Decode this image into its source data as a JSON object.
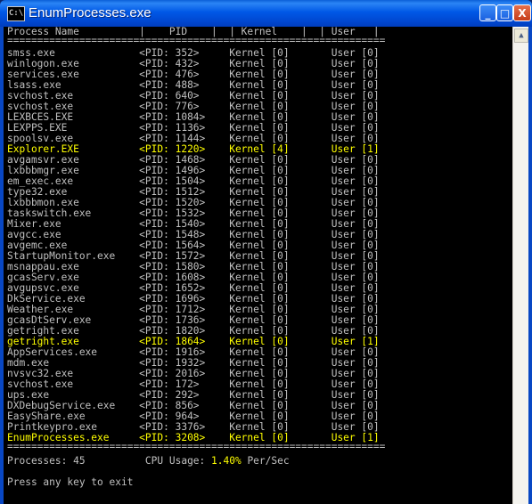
{
  "window": {
    "title": "EnumProcesses.exe",
    "icon_text": "C:\\",
    "buttons": {
      "minimize": "_",
      "maximize": "□",
      "close": "X"
    }
  },
  "console": {
    "header": "Process Name          |    PID    |  | Kernel    |  | User   |",
    "separator_top": "===============================================================",
    "rows": [
      {
        "text": "smss.exe              <PID: 352>     Kernel [0]       User [0]",
        "highlight": false
      },
      {
        "text": "winlogon.exe          <PID: 432>     Kernel [0]       User [0]",
        "highlight": false
      },
      {
        "text": "services.exe          <PID: 476>     Kernel [0]       User [0]",
        "highlight": false
      },
      {
        "text": "lsass.exe             <PID: 488>     Kernel [0]       User [0]",
        "highlight": false
      },
      {
        "text": "svchost.exe           <PID: 640>     Kernel [0]       User [0]",
        "highlight": false
      },
      {
        "text": "svchost.exe           <PID: 776>     Kernel [0]       User [0]",
        "highlight": false
      },
      {
        "text": "LEXBCES.EXE           <PID: 1084>    Kernel [0]       User [0]",
        "highlight": false
      },
      {
        "text": "LEXPPS.EXE            <PID: 1136>    Kernel [0]       User [0]",
        "highlight": false
      },
      {
        "text": "spoolsv.exe           <PID: 1144>    Kernel [0]       User [0]",
        "highlight": false
      },
      {
        "text": "Explorer.EXE          <PID: 1220>    Kernel [4]       User [1]",
        "highlight": true
      },
      {
        "text": "avgamsvr.exe          <PID: 1468>    Kernel [0]       User [0]",
        "highlight": false
      },
      {
        "text": "lxbbbmgr.exe          <PID: 1496>    Kernel [0]       User [0]",
        "highlight": false
      },
      {
        "text": "em_exec.exe           <PID: 1504>    Kernel [0]       User [0]",
        "highlight": false
      },
      {
        "text": "type32.exe            <PID: 1512>    Kernel [0]       User [0]",
        "highlight": false
      },
      {
        "text": "lxbbbmon.exe          <PID: 1520>    Kernel [0]       User [0]",
        "highlight": false
      },
      {
        "text": "taskswitch.exe        <PID: 1532>    Kernel [0]       User [0]",
        "highlight": false
      },
      {
        "text": "Mixer.exe             <PID: 1540>    Kernel [0]       User [0]",
        "highlight": false
      },
      {
        "text": "avgcc.exe             <PID: 1548>    Kernel [0]       User [0]",
        "highlight": false
      },
      {
        "text": "avgemc.exe            <PID: 1564>    Kernel [0]       User [0]",
        "highlight": false
      },
      {
        "text": "StartupMonitor.exe    <PID: 1572>    Kernel [0]       User [0]",
        "highlight": false
      },
      {
        "text": "msnappau.exe          <PID: 1580>    Kernel [0]       User [0]",
        "highlight": false
      },
      {
        "text": "gcasServ.exe          <PID: 1608>    Kernel [0]       User [0]",
        "highlight": false
      },
      {
        "text": "avgupsvc.exe          <PID: 1652>    Kernel [0]       User [0]",
        "highlight": false
      },
      {
        "text": "DkService.exe         <PID: 1696>    Kernel [0]       User [0]",
        "highlight": false
      },
      {
        "text": "Weather.exe           <PID: 1712>    Kernel [0]       User [0]",
        "highlight": false
      },
      {
        "text": "gcasDtServ.exe        <PID: 1736>    Kernel [0]       User [0]",
        "highlight": false
      },
      {
        "text": "getright.exe          <PID: 1820>    Kernel [0]       User [0]",
        "highlight": false
      },
      {
        "text": "getright.exe          <PID: 1864>    Kernel [0]       User [1]",
        "highlight": true
      },
      {
        "text": "AppServices.exe       <PID: 1916>    Kernel [0]       User [0]",
        "highlight": false
      },
      {
        "text": "mdm.exe               <PID: 1932>    Kernel [0]       User [0]",
        "highlight": false
      },
      {
        "text": "nvsvc32.exe           <PID: 2016>    Kernel [0]       User [0]",
        "highlight": false
      },
      {
        "text": "svchost.exe           <PID: 172>     Kernel [0]       User [0]",
        "highlight": false
      },
      {
        "text": "ups.exe               <PID: 292>     Kernel [0]       User [0]",
        "highlight": false
      },
      {
        "text": "DXDebugService.exe    <PID: 856>     Kernel [0]       User [0]",
        "highlight": false
      },
      {
        "text": "EasyShare.exe         <PID: 964>     Kernel [0]       User [0]",
        "highlight": false
      },
      {
        "text": "Printkeypro.exe       <PID: 3376>    Kernel [0]       User [0]",
        "highlight": false
      },
      {
        "text": "EnumProcesses.exe     <PID: 3208>    Kernel [0]       User [1]",
        "highlight": true
      }
    ],
    "separator_bottom": "===============================================================",
    "summary_label": "Processes: 45          CPU Usage: ",
    "cpu_usage": "1.40%",
    "summary_suffix": " Per/Sec",
    "prompt": "Press any key to exit"
  },
  "colors": {
    "console_bg": "#000000",
    "console_text": "#c0c0c0",
    "highlight": "#ffff00",
    "titlebar": "#0058e6"
  },
  "scrollbar": {
    "up_arrow": "▲"
  }
}
